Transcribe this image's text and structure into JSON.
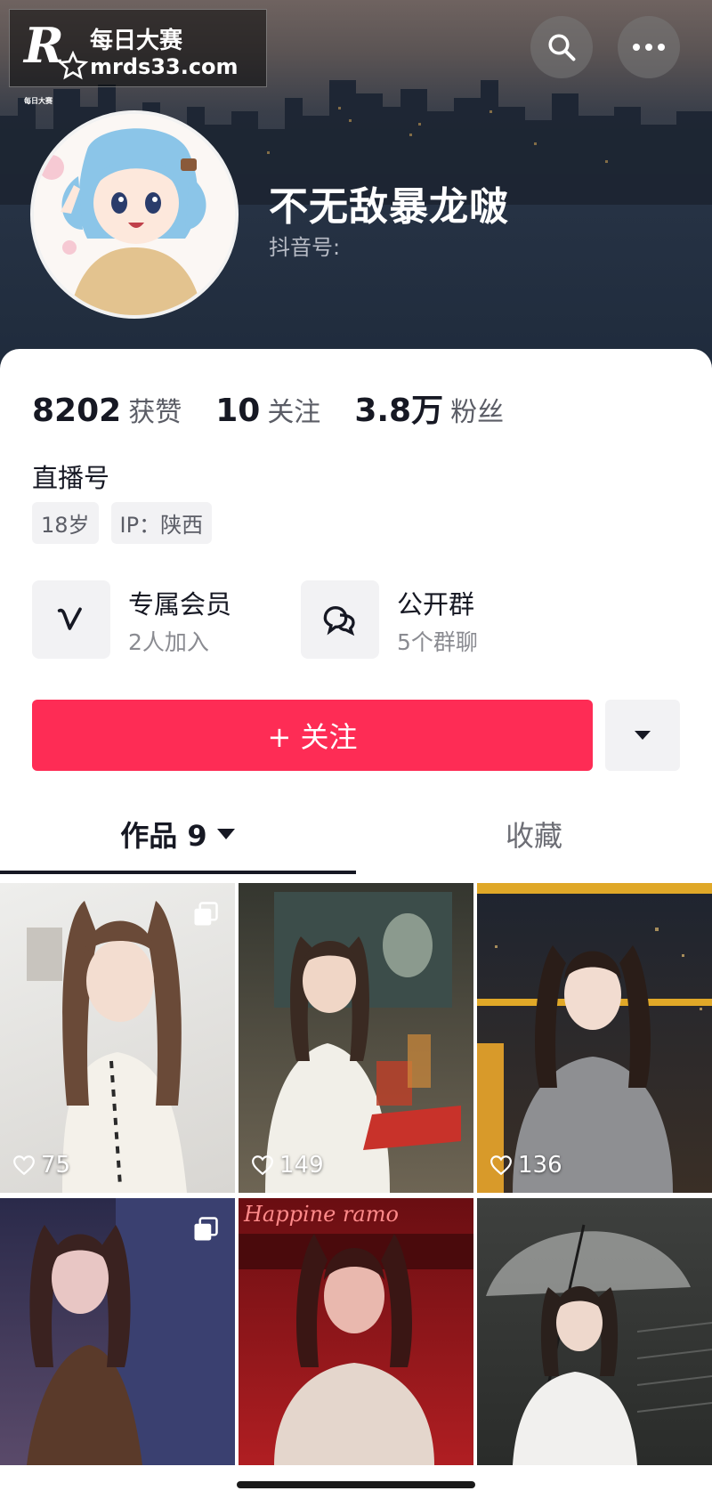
{
  "watermark": {
    "logo_letter": "R",
    "logo_small": "每日大赛",
    "title": "每日大赛",
    "url": "mrds33.com"
  },
  "header": {
    "search_icon": "search-icon",
    "more_icon": "more-dots-icon"
  },
  "profile": {
    "nickname": "不无敌暴龙啵",
    "douyin_id_label": "抖音号:"
  },
  "stats": [
    {
      "value": "8202",
      "label": "获赞"
    },
    {
      "value": "10",
      "label": "关注"
    },
    {
      "value": "3.8万",
      "label": "粉丝"
    }
  ],
  "live_id": "直播号",
  "tags": [
    "18岁",
    "IP：陕西"
  ],
  "features": [
    {
      "icon": "vip-v-icon",
      "title": "专属会员",
      "subtitle": "2人加入"
    },
    {
      "icon": "group-chat-icon",
      "title": "公开群",
      "subtitle": "5个群聊"
    }
  ],
  "follow_button": {
    "label": "+ 关注"
  },
  "tabs": {
    "works": "作品 9",
    "favorites": "收藏"
  },
  "grid": [
    {
      "likes": "75",
      "multi": true
    },
    {
      "likes": "149",
      "multi": false
    },
    {
      "likes": "136",
      "multi": false
    },
    {
      "likes": "",
      "multi": true
    },
    {
      "likes": "",
      "multi": false
    },
    {
      "likes": "",
      "multi": false
    }
  ],
  "grid_text": {
    "neon_sign": "Happine    ramo"
  },
  "colors": {
    "accent": "#fe2c55",
    "text": "#161823",
    "muted": "#8a8b91"
  }
}
